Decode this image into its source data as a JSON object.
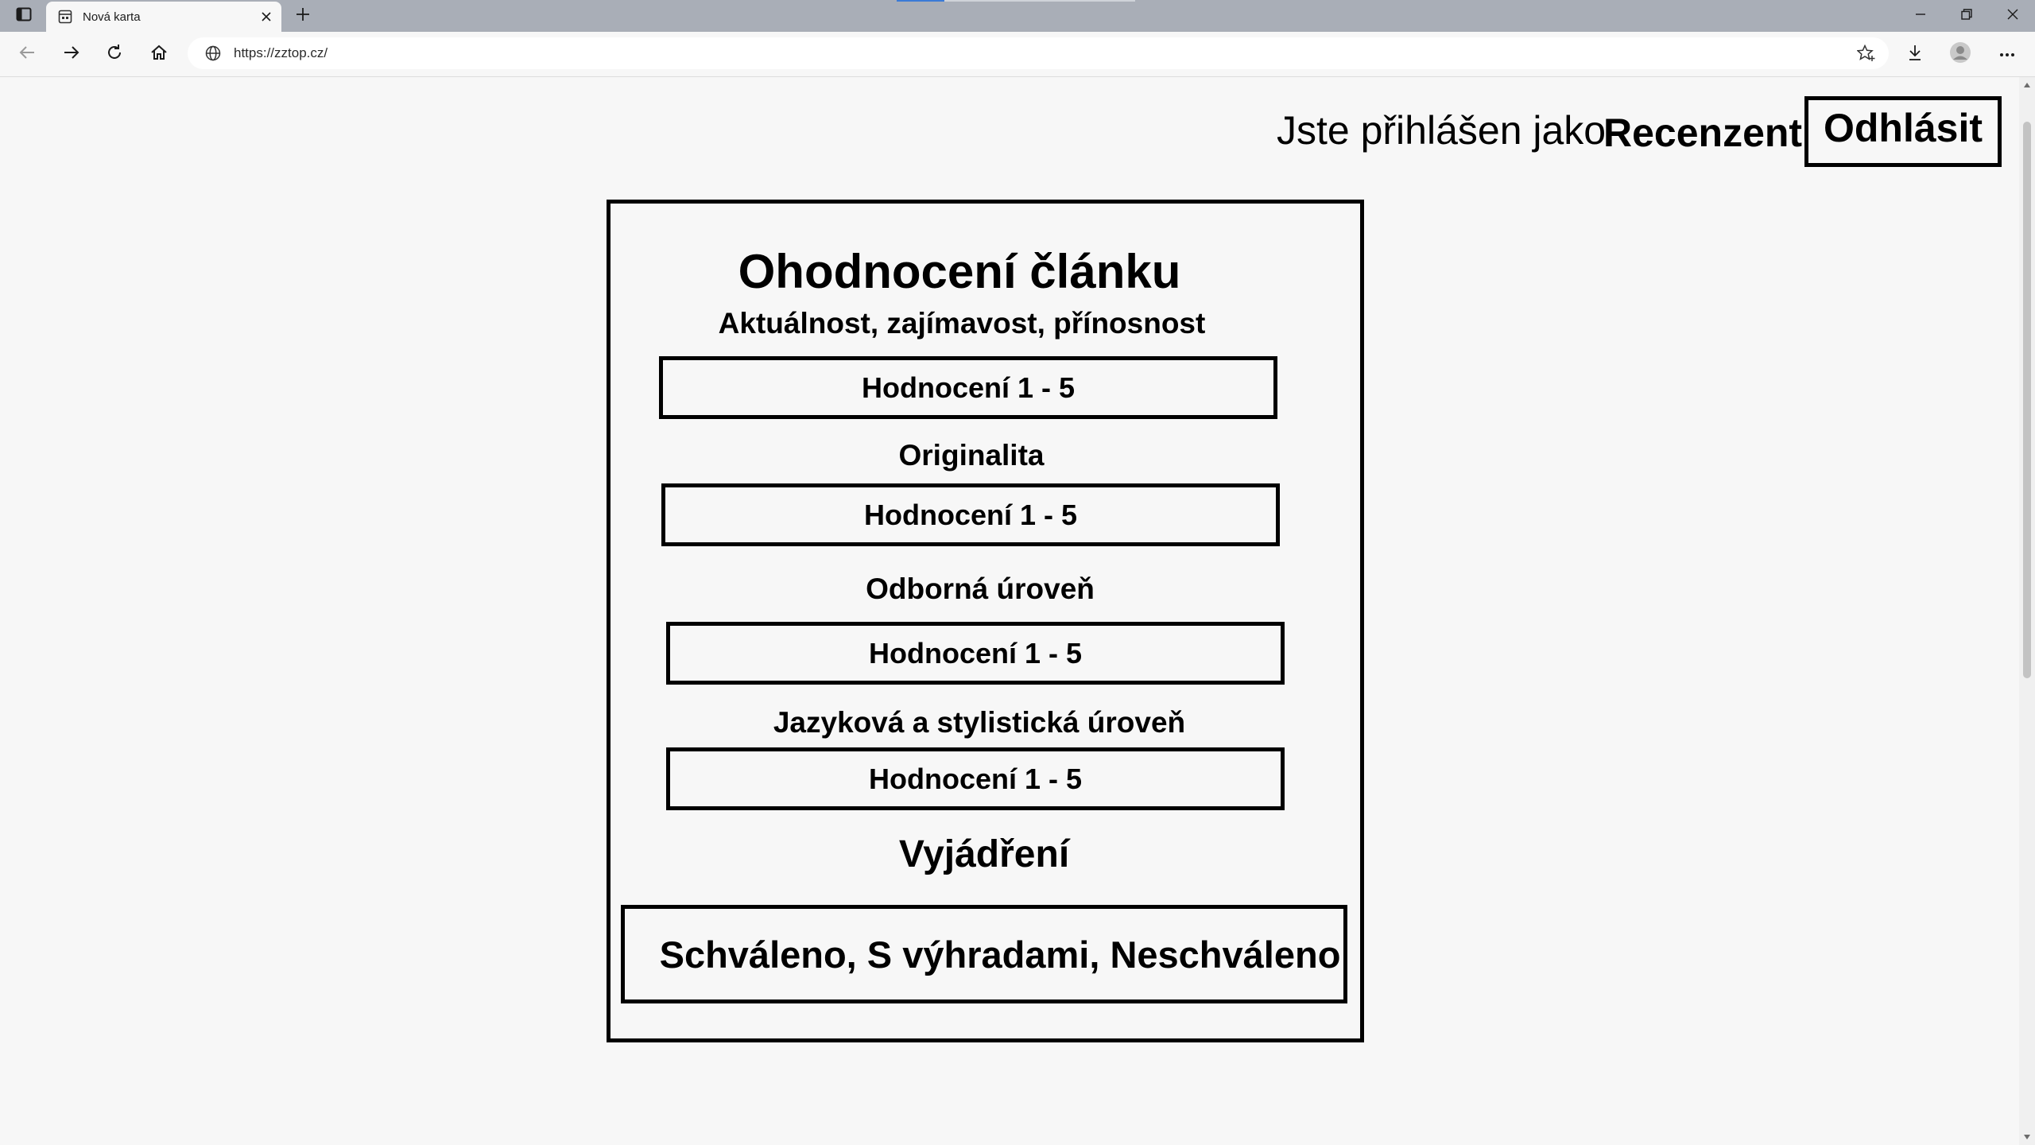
{
  "browser": {
    "tab_title": "Nová karta",
    "url": "https://zztop.cz/",
    "load_progress_pct": 20
  },
  "header": {
    "logged_in_text": "Jste přihlášen jako",
    "role": "Recenzent",
    "logout_label": "Odhlásit"
  },
  "review": {
    "title": "Ohodnocení článku",
    "criteria": [
      {
        "label": "Aktuálnost, zajímavost, přínosnost",
        "placeholder": "Hodnocení 1 - 5"
      },
      {
        "label": "Originalita",
        "placeholder": "Hodnocení 1 - 5"
      },
      {
        "label": "Odborná úroveň",
        "placeholder": "Hodnocení 1 - 5"
      },
      {
        "label": "Jazyková a stylistická úroveň",
        "placeholder": "Hodnocení 1 - 5"
      }
    ],
    "verdict_heading": "Vyjádření",
    "verdict_options": "Schváleno, S výhradami, Neschváleno"
  },
  "colors": {
    "tabbar": "#a9aeb7",
    "page_bg": "#f7f7f7",
    "border": "#000000",
    "progress": "#3b7bd6"
  }
}
